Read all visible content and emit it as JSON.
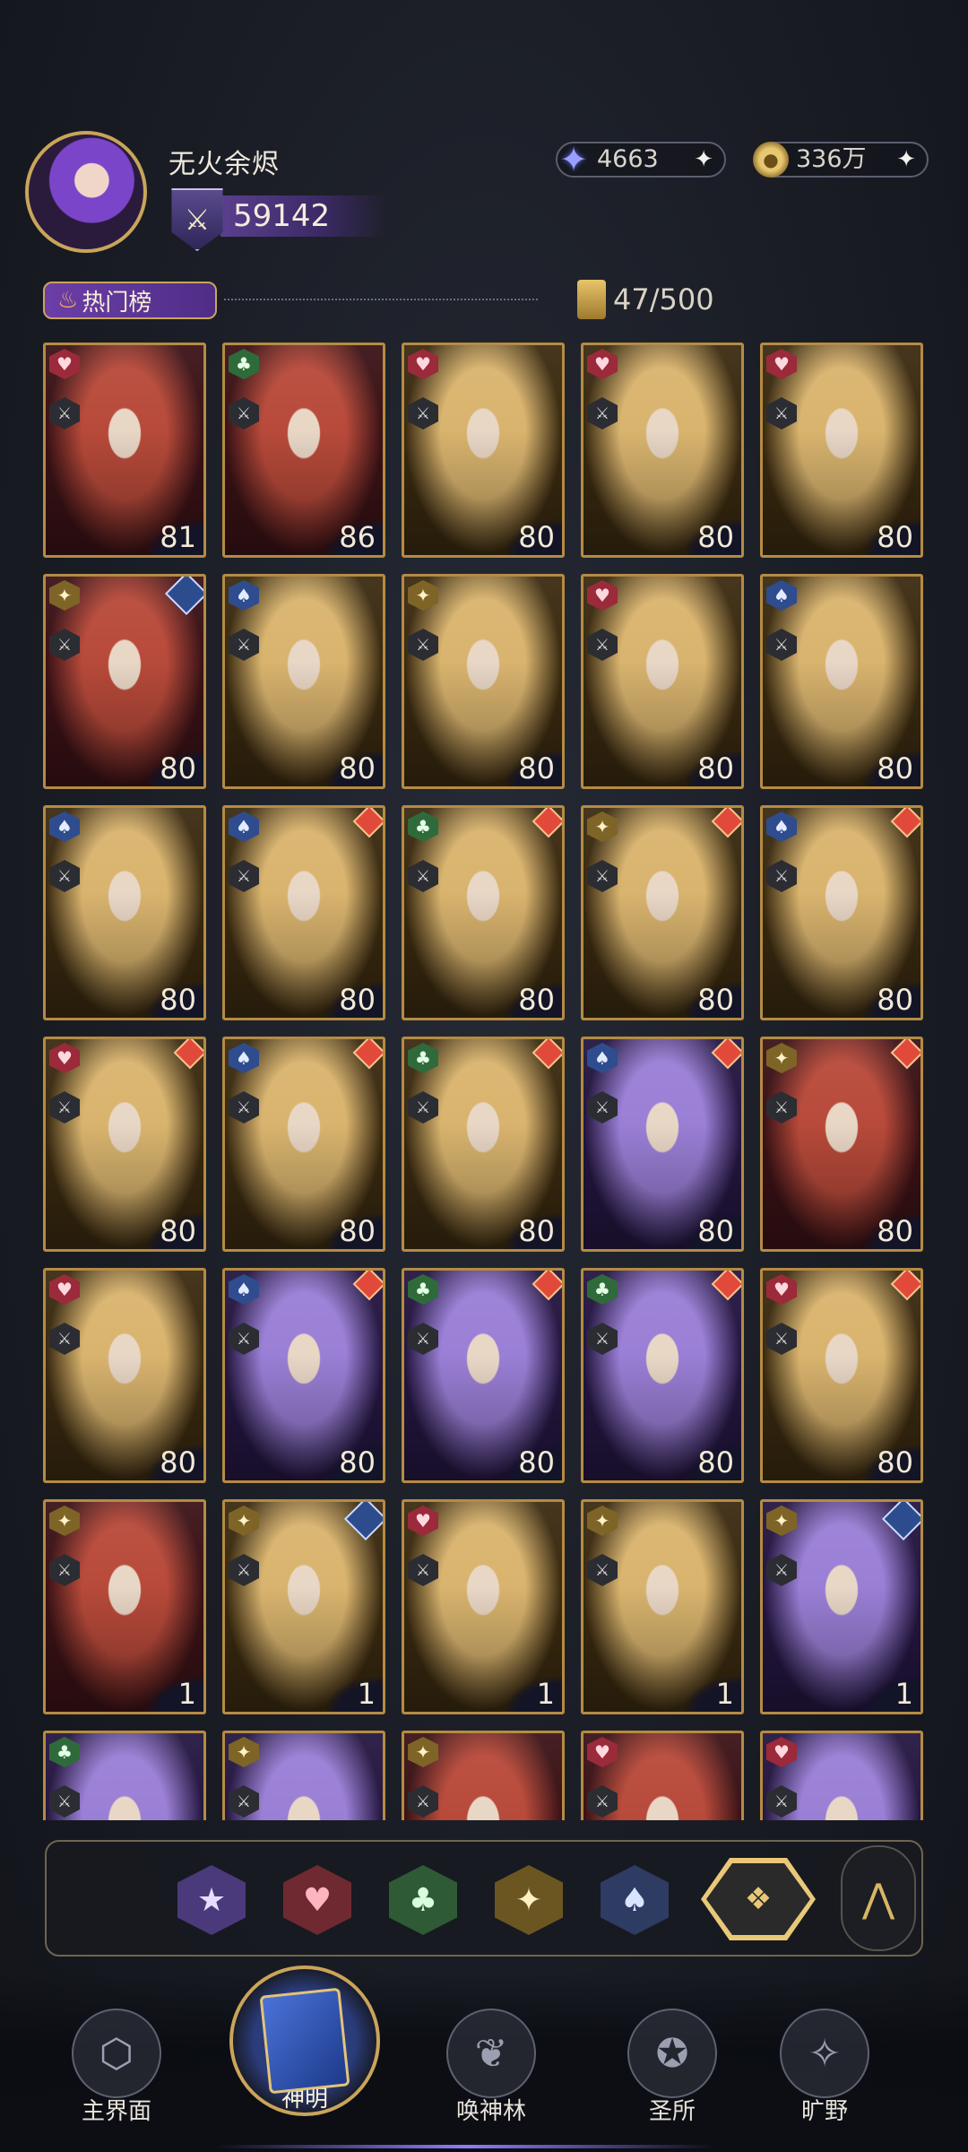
{
  "player": {
    "name": "无火余烬",
    "power": "59142"
  },
  "currency": {
    "gems": "4663",
    "gold": "336万",
    "plus": "+"
  },
  "section": {
    "label": "热门榜",
    "card_count": "47/500"
  },
  "suit_glyphs": {
    "heart": "♥",
    "club": "♣",
    "star": "✦",
    "spade": "♠"
  },
  "cards": [
    {
      "suit": "heart",
      "level": "81",
      "frame": "red",
      "star": ""
    },
    {
      "suit": "club",
      "level": "86",
      "frame": "red",
      "star": ""
    },
    {
      "suit": "heart",
      "level": "80",
      "frame": "gold",
      "star": ""
    },
    {
      "suit": "heart",
      "level": "80",
      "frame": "gold",
      "star": ""
    },
    {
      "suit": "heart",
      "level": "80",
      "frame": "gold",
      "star": ""
    },
    {
      "suit": "star",
      "level": "80",
      "frame": "red",
      "star": "blue"
    },
    {
      "suit": "spade",
      "level": "80",
      "frame": "gold",
      "star": ""
    },
    {
      "suit": "star",
      "level": "80",
      "frame": "gold",
      "star": ""
    },
    {
      "suit": "heart",
      "level": "80",
      "frame": "gold",
      "star": ""
    },
    {
      "suit": "spade",
      "level": "80",
      "frame": "gold",
      "star": ""
    },
    {
      "suit": "spade",
      "level": "80",
      "frame": "gold",
      "star": ""
    },
    {
      "suit": "spade",
      "level": "80",
      "frame": "gold",
      "star": "red"
    },
    {
      "suit": "club",
      "level": "80",
      "frame": "gold",
      "star": "red"
    },
    {
      "suit": "star",
      "level": "80",
      "frame": "gold",
      "star": "red"
    },
    {
      "suit": "spade",
      "level": "80",
      "frame": "gold",
      "star": "red"
    },
    {
      "suit": "heart",
      "level": "80",
      "frame": "gold",
      "star": "red"
    },
    {
      "suit": "spade",
      "level": "80",
      "frame": "gold",
      "star": "red"
    },
    {
      "suit": "club",
      "level": "80",
      "frame": "gold",
      "star": "red"
    },
    {
      "suit": "spade",
      "level": "80",
      "frame": "purple",
      "star": "red"
    },
    {
      "suit": "star",
      "level": "80",
      "frame": "red",
      "star": "red"
    },
    {
      "suit": "heart",
      "level": "80",
      "frame": "gold",
      "star": ""
    },
    {
      "suit": "spade",
      "level": "80",
      "frame": "purple",
      "star": "red"
    },
    {
      "suit": "club",
      "level": "80",
      "frame": "purple",
      "star": "red"
    },
    {
      "suit": "club",
      "level": "80",
      "frame": "purple",
      "star": "red"
    },
    {
      "suit": "heart",
      "level": "80",
      "frame": "gold",
      "star": "red"
    },
    {
      "suit": "star",
      "level": "1",
      "frame": "red",
      "star": ""
    },
    {
      "suit": "star",
      "level": "1",
      "frame": "gold",
      "star": "blue"
    },
    {
      "suit": "heart",
      "level": "1",
      "frame": "gold",
      "star": ""
    },
    {
      "suit": "star",
      "level": "1",
      "frame": "gold",
      "star": ""
    },
    {
      "suit": "star",
      "level": "1",
      "frame": "purple",
      "star": "blue"
    },
    {
      "suit": "club",
      "level": "",
      "frame": "purple",
      "star": ""
    },
    {
      "suit": "star",
      "level": "",
      "frame": "purple",
      "star": ""
    },
    {
      "suit": "star",
      "level": "",
      "frame": "red",
      "star": ""
    },
    {
      "suit": "heart",
      "level": "",
      "frame": "red",
      "star": ""
    },
    {
      "suit": "heart",
      "level": "",
      "frame": "purple",
      "star": ""
    }
  ],
  "filters": [
    "star",
    "heart",
    "club",
    "diamond",
    "spade",
    "all"
  ],
  "nav": {
    "home": "主界面",
    "gods": "神明",
    "summon": "唤神林",
    "sanctum": "圣所",
    "wild": "旷野"
  }
}
